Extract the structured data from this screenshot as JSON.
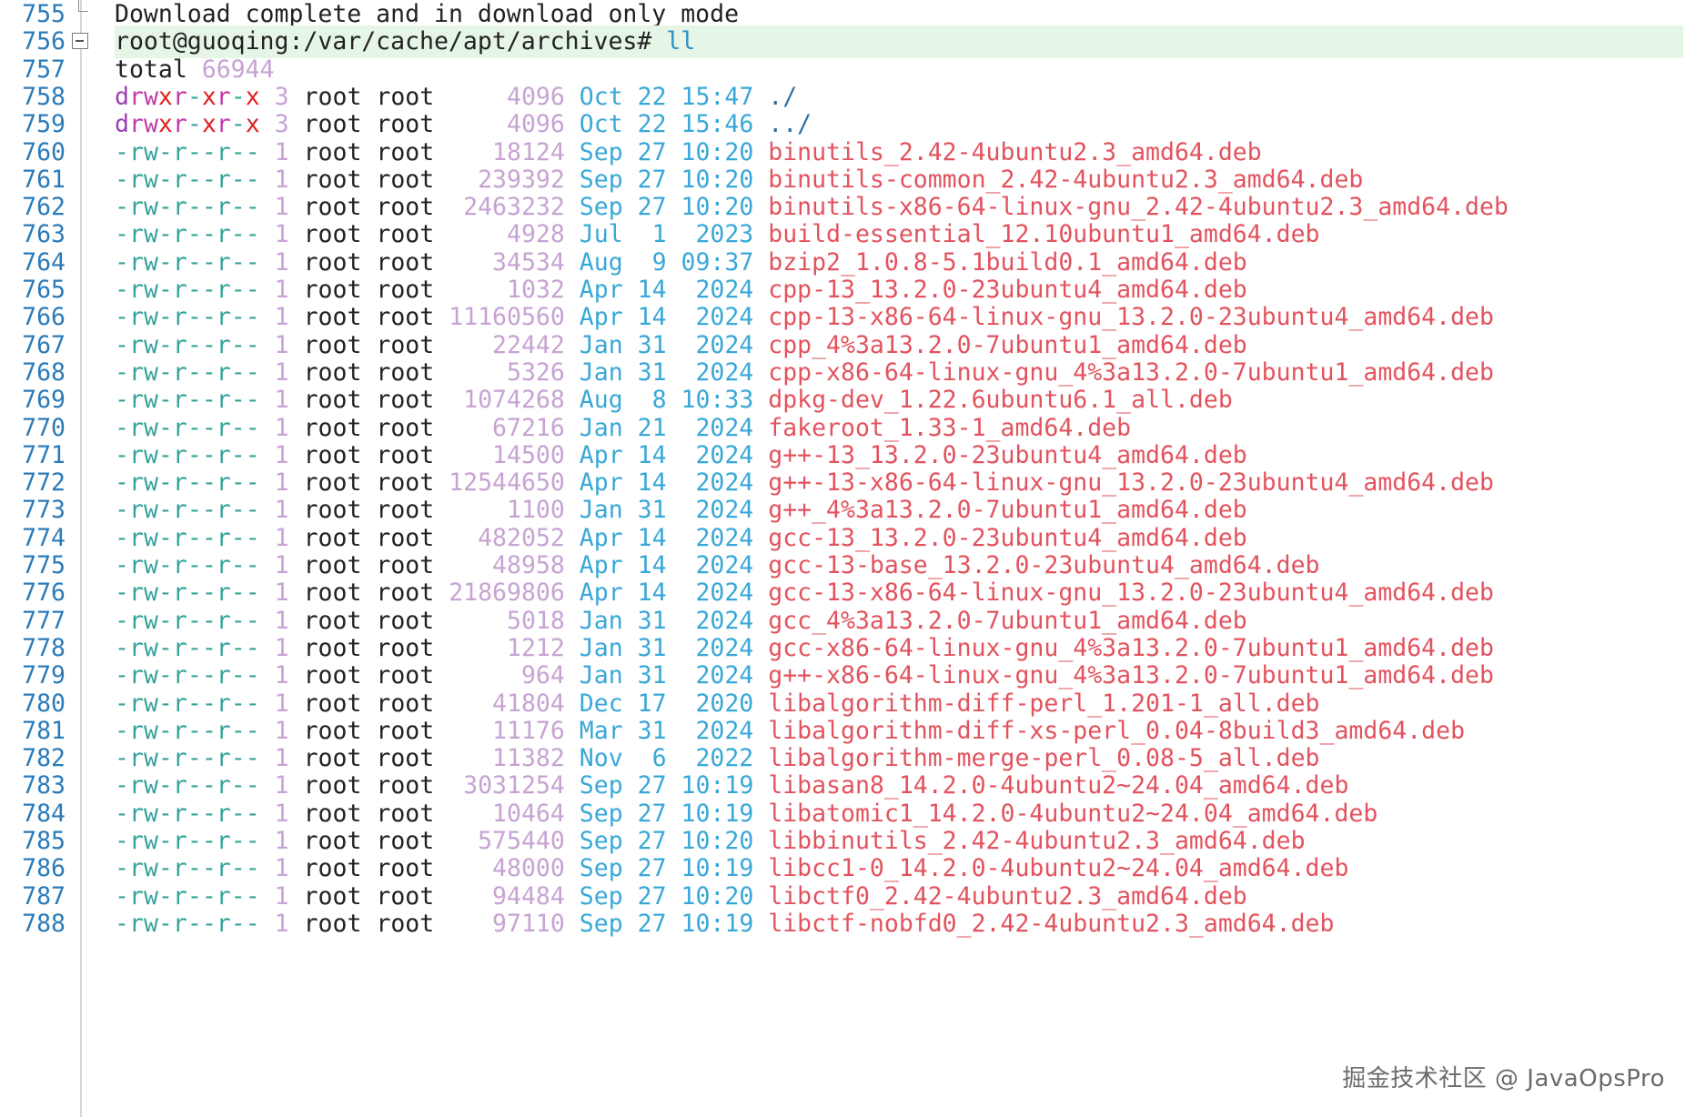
{
  "lines": [
    {
      "n": "755",
      "type": "text",
      "text": "Download complete and in download only mode",
      "fold": "end"
    },
    {
      "n": "756",
      "type": "prompt",
      "prompt": "root@guoqing:/var/cache/apt/archives# ",
      "cmd": "ll",
      "fold": "box",
      "highlight": true
    },
    {
      "n": "757",
      "type": "total",
      "label": "total ",
      "value": "66944"
    },
    {
      "n": "758",
      "type": "entry",
      "kind": "dir",
      "perm": "drwxr-xr-x",
      "links": "3",
      "user": "root",
      "group": "root",
      "size": "4096",
      "month": "Oct",
      "day": "22",
      "time": "15:47",
      "name": "./"
    },
    {
      "n": "759",
      "type": "entry",
      "kind": "dir",
      "perm": "drwxr-xr-x",
      "links": "3",
      "user": "root",
      "group": "root",
      "size": "4096",
      "month": "Oct",
      "day": "22",
      "time": "15:46",
      "name": "../"
    },
    {
      "n": "760",
      "type": "entry",
      "kind": "file",
      "perm": "-rw-r--r--",
      "links": "1",
      "user": "root",
      "group": "root",
      "size": "18124",
      "month": "Sep",
      "day": "27",
      "time": "10:20",
      "name": "binutils_2.42-4ubuntu2.3_amd64.deb"
    },
    {
      "n": "761",
      "type": "entry",
      "kind": "file",
      "perm": "-rw-r--r--",
      "links": "1",
      "user": "root",
      "group": "root",
      "size": "239392",
      "month": "Sep",
      "day": "27",
      "time": "10:20",
      "name": "binutils-common_2.42-4ubuntu2.3_amd64.deb"
    },
    {
      "n": "762",
      "type": "entry",
      "kind": "file",
      "perm": "-rw-r--r--",
      "links": "1",
      "user": "root",
      "group": "root",
      "size": "2463232",
      "month": "Sep",
      "day": "27",
      "time": "10:20",
      "name": "binutils-x86-64-linux-gnu_2.42-4ubuntu2.3_amd64.deb"
    },
    {
      "n": "763",
      "type": "entry",
      "kind": "file",
      "perm": "-rw-r--r--",
      "links": "1",
      "user": "root",
      "group": "root",
      "size": "4928",
      "month": "Jul",
      "day": "1",
      "time": "2023",
      "name": "build-essential_12.10ubuntu1_amd64.deb"
    },
    {
      "n": "764",
      "type": "entry",
      "kind": "file",
      "perm": "-rw-r--r--",
      "links": "1",
      "user": "root",
      "group": "root",
      "size": "34534",
      "month": "Aug",
      "day": "9",
      "time": "09:37",
      "name": "bzip2_1.0.8-5.1build0.1_amd64.deb"
    },
    {
      "n": "765",
      "type": "entry",
      "kind": "file",
      "perm": "-rw-r--r--",
      "links": "1",
      "user": "root",
      "group": "root",
      "size": "1032",
      "month": "Apr",
      "day": "14",
      "time": "2024",
      "name": "cpp-13_13.2.0-23ubuntu4_amd64.deb"
    },
    {
      "n": "766",
      "type": "entry",
      "kind": "file",
      "perm": "-rw-r--r--",
      "links": "1",
      "user": "root",
      "group": "root",
      "size": "11160560",
      "month": "Apr",
      "day": "14",
      "time": "2024",
      "name": "cpp-13-x86-64-linux-gnu_13.2.0-23ubuntu4_amd64.deb"
    },
    {
      "n": "767",
      "type": "entry",
      "kind": "file",
      "perm": "-rw-r--r--",
      "links": "1",
      "user": "root",
      "group": "root",
      "size": "22442",
      "month": "Jan",
      "day": "31",
      "time": "2024",
      "name": "cpp_4%3a13.2.0-7ubuntu1_amd64.deb"
    },
    {
      "n": "768",
      "type": "entry",
      "kind": "file",
      "perm": "-rw-r--r--",
      "links": "1",
      "user": "root",
      "group": "root",
      "size": "5326",
      "month": "Jan",
      "day": "31",
      "time": "2024",
      "name": "cpp-x86-64-linux-gnu_4%3a13.2.0-7ubuntu1_amd64.deb"
    },
    {
      "n": "769",
      "type": "entry",
      "kind": "file",
      "perm": "-rw-r--r--",
      "links": "1",
      "user": "root",
      "group": "root",
      "size": "1074268",
      "month": "Aug",
      "day": "8",
      "time": "10:33",
      "name": "dpkg-dev_1.22.6ubuntu6.1_all.deb"
    },
    {
      "n": "770",
      "type": "entry",
      "kind": "file",
      "perm": "-rw-r--r--",
      "links": "1",
      "user": "root",
      "group": "root",
      "size": "67216",
      "month": "Jan",
      "day": "21",
      "time": "2024",
      "name": "fakeroot_1.33-1_amd64.deb"
    },
    {
      "n": "771",
      "type": "entry",
      "kind": "file",
      "perm": "-rw-r--r--",
      "links": "1",
      "user": "root",
      "group": "root",
      "size": "14500",
      "month": "Apr",
      "day": "14",
      "time": "2024",
      "name": "g++-13_13.2.0-23ubuntu4_amd64.deb"
    },
    {
      "n": "772",
      "type": "entry",
      "kind": "file",
      "perm": "-rw-r--r--",
      "links": "1",
      "user": "root",
      "group": "root",
      "size": "12544650",
      "month": "Apr",
      "day": "14",
      "time": "2024",
      "name": "g++-13-x86-64-linux-gnu_13.2.0-23ubuntu4_amd64.deb"
    },
    {
      "n": "773",
      "type": "entry",
      "kind": "file",
      "perm": "-rw-r--r--",
      "links": "1",
      "user": "root",
      "group": "root",
      "size": "1100",
      "month": "Jan",
      "day": "31",
      "time": "2024",
      "name": "g++_4%3a13.2.0-7ubuntu1_amd64.deb"
    },
    {
      "n": "774",
      "type": "entry",
      "kind": "file",
      "perm": "-rw-r--r--",
      "links": "1",
      "user": "root",
      "group": "root",
      "size": "482052",
      "month": "Apr",
      "day": "14",
      "time": "2024",
      "name": "gcc-13_13.2.0-23ubuntu4_amd64.deb"
    },
    {
      "n": "775",
      "type": "entry",
      "kind": "file",
      "perm": "-rw-r--r--",
      "links": "1",
      "user": "root",
      "group": "root",
      "size": "48958",
      "month": "Apr",
      "day": "14",
      "time": "2024",
      "name": "gcc-13-base_13.2.0-23ubuntu4_amd64.deb"
    },
    {
      "n": "776",
      "type": "entry",
      "kind": "file",
      "perm": "-rw-r--r--",
      "links": "1",
      "user": "root",
      "group": "root",
      "size": "21869806",
      "month": "Apr",
      "day": "14",
      "time": "2024",
      "name": "gcc-13-x86-64-linux-gnu_13.2.0-23ubuntu4_amd64.deb"
    },
    {
      "n": "777",
      "type": "entry",
      "kind": "file",
      "perm": "-rw-r--r--",
      "links": "1",
      "user": "root",
      "group": "root",
      "size": "5018",
      "month": "Jan",
      "day": "31",
      "time": "2024",
      "name": "gcc_4%3a13.2.0-7ubuntu1_amd64.deb"
    },
    {
      "n": "778",
      "type": "entry",
      "kind": "file",
      "perm": "-rw-r--r--",
      "links": "1",
      "user": "root",
      "group": "root",
      "size": "1212",
      "month": "Jan",
      "day": "31",
      "time": "2024",
      "name": "gcc-x86-64-linux-gnu_4%3a13.2.0-7ubuntu1_amd64.deb"
    },
    {
      "n": "779",
      "type": "entry",
      "kind": "file",
      "perm": "-rw-r--r--",
      "links": "1",
      "user": "root",
      "group": "root",
      "size": "964",
      "month": "Jan",
      "day": "31",
      "time": "2024",
      "name": "g++-x86-64-linux-gnu_4%3a13.2.0-7ubuntu1_amd64.deb"
    },
    {
      "n": "780",
      "type": "entry",
      "kind": "file",
      "perm": "-rw-r--r--",
      "links": "1",
      "user": "root",
      "group": "root",
      "size": "41804",
      "month": "Dec",
      "day": "17",
      "time": "2020",
      "name": "libalgorithm-diff-perl_1.201-1_all.deb"
    },
    {
      "n": "781",
      "type": "entry",
      "kind": "file",
      "perm": "-rw-r--r--",
      "links": "1",
      "user": "root",
      "group": "root",
      "size": "11176",
      "month": "Mar",
      "day": "31",
      "time": "2024",
      "name": "libalgorithm-diff-xs-perl_0.04-8build3_amd64.deb"
    },
    {
      "n": "782",
      "type": "entry",
      "kind": "file",
      "perm": "-rw-r--r--",
      "links": "1",
      "user": "root",
      "group": "root",
      "size": "11382",
      "month": "Nov",
      "day": "6",
      "time": "2022",
      "name": "libalgorithm-merge-perl_0.08-5_all.deb"
    },
    {
      "n": "783",
      "type": "entry",
      "kind": "file",
      "perm": "-rw-r--r--",
      "links": "1",
      "user": "root",
      "group": "root",
      "size": "3031254",
      "month": "Sep",
      "day": "27",
      "time": "10:19",
      "name": "libasan8_14.2.0-4ubuntu2~24.04_amd64.deb"
    },
    {
      "n": "784",
      "type": "entry",
      "kind": "file",
      "perm": "-rw-r--r--",
      "links": "1",
      "user": "root",
      "group": "root",
      "size": "10464",
      "month": "Sep",
      "day": "27",
      "time": "10:19",
      "name": "libatomic1_14.2.0-4ubuntu2~24.04_amd64.deb"
    },
    {
      "n": "785",
      "type": "entry",
      "kind": "file",
      "perm": "-rw-r--r--",
      "links": "1",
      "user": "root",
      "group": "root",
      "size": "575440",
      "month": "Sep",
      "day": "27",
      "time": "10:20",
      "name": "libbinutils_2.42-4ubuntu2.3_amd64.deb"
    },
    {
      "n": "786",
      "type": "entry",
      "kind": "file",
      "perm": "-rw-r--r--",
      "links": "1",
      "user": "root",
      "group": "root",
      "size": "48000",
      "month": "Sep",
      "day": "27",
      "time": "10:19",
      "name": "libcc1-0_14.2.0-4ubuntu2~24.04_amd64.deb"
    },
    {
      "n": "787",
      "type": "entry",
      "kind": "file",
      "perm": "-rw-r--r--",
      "links": "1",
      "user": "root",
      "group": "root",
      "size": "94484",
      "month": "Sep",
      "day": "27",
      "time": "10:20",
      "name": "libctf0_2.42-4ubuntu2.3_amd64.deb"
    },
    {
      "n": "788",
      "type": "entry",
      "kind": "file",
      "perm": "-rw-r--r--",
      "links": "1",
      "user": "root",
      "group": "root",
      "size": "97110",
      "month": "Sep",
      "day": "27",
      "time": "10:19",
      "name": "libctf-nobfd0_2.42-4ubuntu2.3_amd64.deb"
    }
  ],
  "watermark": "掘金技术社区 @ JavaOpsPro",
  "colors": {
    "line_number": "#2b7bb9",
    "filename_deb": "#e2535e",
    "dir_name": "#2d6fa3",
    "date": "#39a8d8",
    "size": "#c7a3d3",
    "highlight_bg": "#e6f6e6"
  }
}
